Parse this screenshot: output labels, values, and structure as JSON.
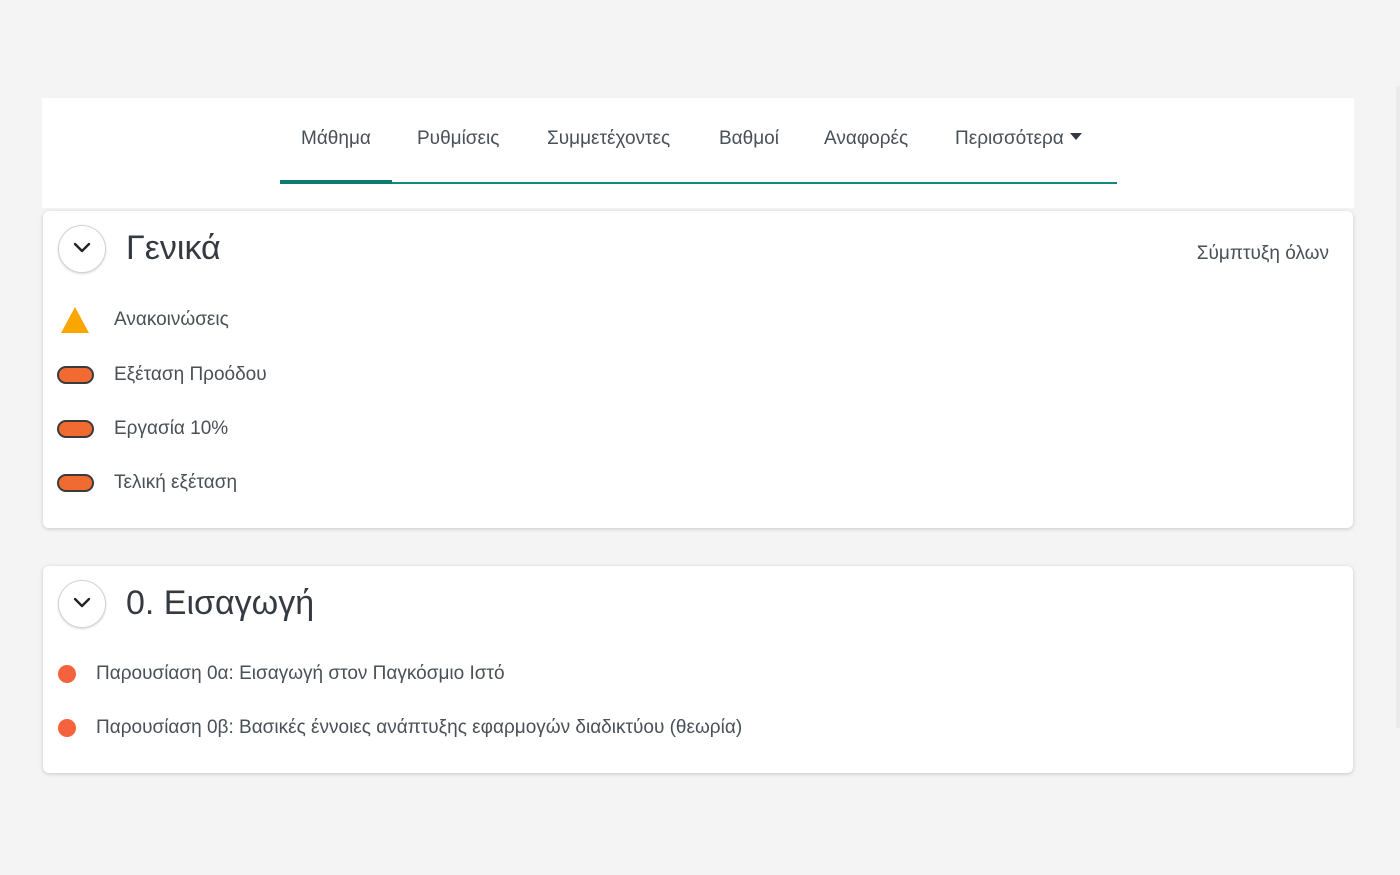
{
  "nav": {
    "tabs": [
      {
        "label": "Μάθημα",
        "active": true
      },
      {
        "label": "Ρυθμίσεις"
      },
      {
        "label": "Συμμετέχοντες"
      },
      {
        "label": "Βαθμοί"
      },
      {
        "label": "Αναφορές"
      },
      {
        "label": "Περισσότερα",
        "icon": "caret-down-icon"
      }
    ],
    "accent_color": "#0f7a70"
  },
  "sections": [
    {
      "title": "Γενικά",
      "collapse_all_label": "Σύμπτυξη όλων",
      "toggle_icon": "chevron-down-icon",
      "activities": [
        {
          "label": "Ανακοινώσεις",
          "icon": "forum-warning-icon"
        },
        {
          "label": "Εξέταση Προόδου",
          "icon": "assignment-pill-icon"
        },
        {
          "label": "Εργασία 10%",
          "icon": "assignment-pill-icon"
        },
        {
          "label": "Τελική εξέταση",
          "icon": "assignment-pill-icon"
        }
      ]
    },
    {
      "title": "0. Εισαγωγή",
      "toggle_icon": "chevron-down-icon",
      "activities": [
        {
          "label": "Παρουσίαση 0α: Εισαγωγή στον Παγκόσμιο Ιστό",
          "icon": "resource-dot-icon"
        },
        {
          "label": "Παρουσίαση 0β: Βασικές έννοιες ανάπτυξης εφαρμογών διαδικτύου (θεωρία)",
          "icon": "resource-dot-icon"
        }
      ]
    }
  ],
  "colors": {
    "assignment": "#f06a32",
    "forum": "#f9a600",
    "resource": "#f5623e"
  }
}
